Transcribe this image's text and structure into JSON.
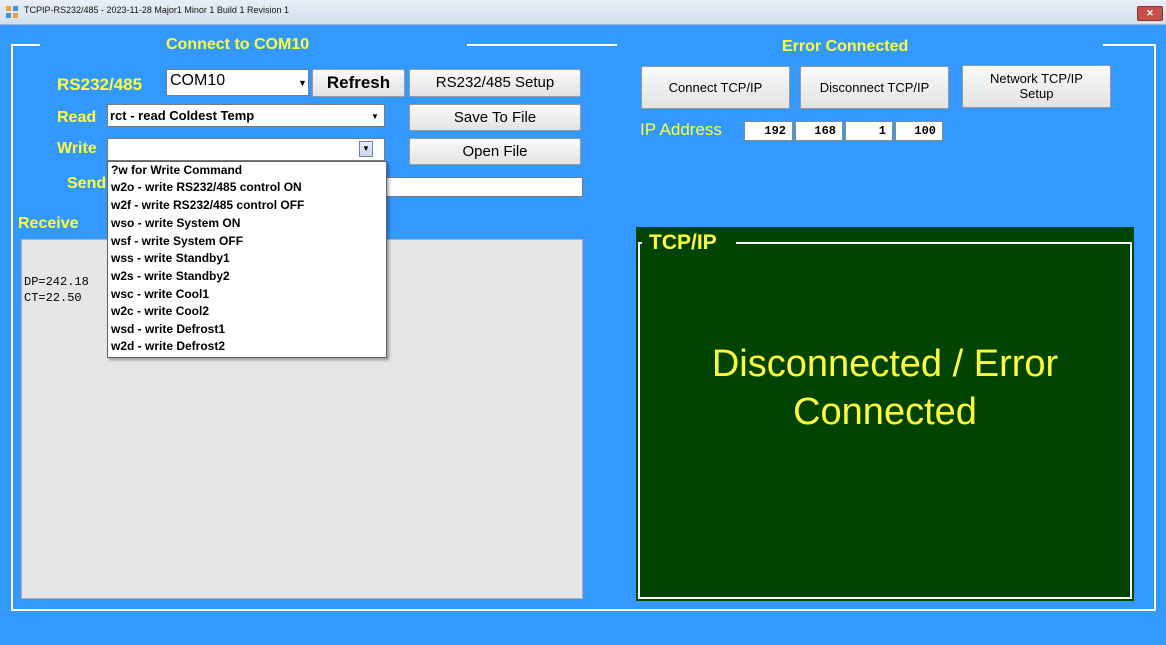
{
  "window": {
    "title": "TCPIP-RS232/485 - 2023-11-28 Major1 Minor 1 Build 1 Revision 1",
    "close_glyph": "✕"
  },
  "com_group": {
    "legend": "Connect to COM10",
    "rs_label": "RS232/485",
    "port_value": "COM10",
    "refresh_label": "Refresh",
    "setup_label": "RS232/485 Setup",
    "read_label": "Read",
    "read_value": "rct - read Coldest Temp",
    "save_label": "Save To File",
    "write_label": "Write",
    "write_value": "",
    "open_label": "Open File",
    "send_label": "Send",
    "send_value": "",
    "receive_label": "Receive",
    "receive_lines": [
      "DP=242.18",
      "CT=22.50"
    ]
  },
  "write_dropdown": {
    "items": [
      "?w for Write Command",
      "w2o - write RS232/485 control ON",
      "w2f - write RS232/485 control OFF",
      "wso - write System ON",
      "wsf - write System OFF",
      "wss - write Standby1",
      "w2s - write Standby2",
      "wsc - write Cool1",
      "w2c - write Cool2",
      "wsd - write Defrost1",
      "w2d - write Defrost2"
    ]
  },
  "tcp_group": {
    "legend": "Error Connected",
    "connect_label": "Connect TCP/IP",
    "disconnect_label": "Disconnect TCP/IP",
    "network_label_1": "Network TCP/IP",
    "network_label_2": "Setup",
    "ip_label": "IP Address",
    "ip": [
      "192",
      "168",
      "1",
      "100"
    ],
    "panel_title": "TCP/IP",
    "status_line_1": "Disconnected / Error",
    "status_line_2": "Connected"
  },
  "colors": {
    "background": "#3399ff",
    "accent_text": "#ffff33",
    "status_panel": "#004400"
  },
  "icons": {
    "app": "app-icon",
    "close": "close-icon",
    "dropdown": "chevron-down-icon"
  }
}
